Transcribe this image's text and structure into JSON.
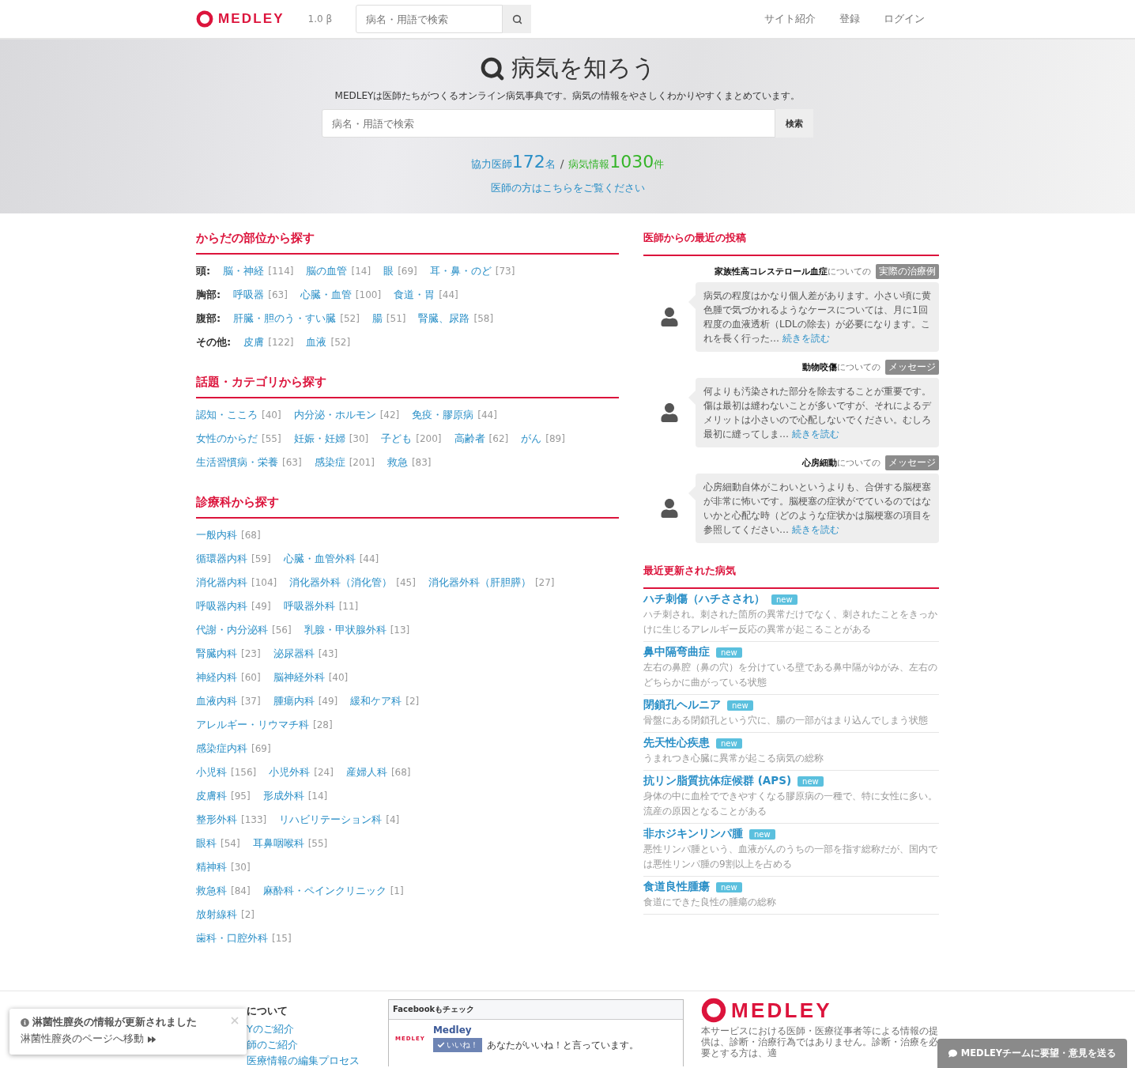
{
  "header": {
    "logo": "MEDLEY",
    "version": "1.0 β",
    "search_placeholder": "病名・用語で検索",
    "nav": [
      "サイト紹介",
      "登録",
      "ログイン"
    ]
  },
  "hero": {
    "title": "病気を知ろう",
    "description": "MEDLEYは医師たちがつくるオンライン病気事典です。病気の情報をやさしくわかりやすくまとめています。",
    "search": {
      "placeholder": "病名・用語で検索",
      "button": "検索"
    },
    "stats": [
      {
        "label": "協力医師",
        "count": "172",
        "unit": "名",
        "color": "#2a8fc7"
      },
      {
        "label": "病気情報",
        "count": "1030",
        "unit": "件",
        "color": "#36b52a"
      }
    ],
    "separator": "/",
    "doctor_link": "医師の方はこちらをご覧ください"
  },
  "body_parts": {
    "title": "からだの部位から探す",
    "rows": [
      {
        "label": "頭:",
        "links": [
          {
            "name": "脳・神経",
            "count": "[114]"
          },
          {
            "name": "脳の血管",
            "count": "[14]"
          },
          {
            "name": "眼",
            "count": "[69]"
          },
          {
            "name": "耳・鼻・のど",
            "count": "[73]"
          }
        ]
      },
      {
        "label": "胸部:",
        "links": [
          {
            "name": "呼吸器",
            "count": "[63]"
          },
          {
            "name": "心臓・血管",
            "count": "[100]"
          },
          {
            "name": "食道・胃",
            "count": "[44]"
          }
        ]
      },
      {
        "label": "腹部:",
        "links": [
          {
            "name": "肝臓・胆のう・すい臓",
            "count": "[52]"
          },
          {
            "name": "腸",
            "count": "[51]"
          },
          {
            "name": "腎臓、尿路",
            "count": "[58]"
          }
        ]
      },
      {
        "label": "その他:",
        "links": [
          {
            "name": "皮膚",
            "count": "[122]"
          },
          {
            "name": "血液",
            "count": "[52]"
          }
        ]
      }
    ]
  },
  "topics": {
    "title": "話題・カテゴリから探す",
    "rows": [
      [
        {
          "name": "認知・こころ",
          "count": "[40]"
        },
        {
          "name": "内分泌・ホルモン",
          "count": "[42]"
        },
        {
          "name": "免疫・膠原病",
          "count": "[44]"
        }
      ],
      [
        {
          "name": "女性のからだ",
          "count": "[55]"
        },
        {
          "name": "妊娠・妊婦",
          "count": "[30]"
        },
        {
          "name": "子ども",
          "count": "[200]"
        },
        {
          "name": "高齢者",
          "count": "[62]"
        },
        {
          "name": "がん",
          "count": "[89]"
        }
      ],
      [
        {
          "name": "生活習慣病・栄養",
          "count": "[63]"
        },
        {
          "name": "感染症",
          "count": "[201]"
        },
        {
          "name": "救急",
          "count": "[83]"
        }
      ]
    ]
  },
  "departments": {
    "title": "診療科から探す",
    "rows": [
      [
        {
          "name": "一般内科",
          "count": "[68]"
        }
      ],
      [
        {
          "name": "循環器内科",
          "count": "[59]"
        },
        {
          "name": "心臓・血管外科",
          "count": "[44]"
        }
      ],
      [
        {
          "name": "消化器内科",
          "count": "[104]"
        },
        {
          "name": "消化器外科（消化管）",
          "count": "[45]"
        },
        {
          "name": "消化器外科（肝胆膵）",
          "count": "[27]"
        }
      ],
      [
        {
          "name": "呼吸器内科",
          "count": "[49]"
        },
        {
          "name": "呼吸器外科",
          "count": "[11]"
        }
      ],
      [
        {
          "name": "代謝・内分泌科",
          "count": "[56]"
        },
        {
          "name": "乳腺・甲状腺外科",
          "count": "[13]"
        }
      ],
      [
        {
          "name": "腎臓内科",
          "count": "[23]"
        },
        {
          "name": "泌尿器科",
          "count": "[43]"
        }
      ],
      [
        {
          "name": "神経内科",
          "count": "[60]"
        },
        {
          "name": "脳神経外科",
          "count": "[40]"
        }
      ],
      [
        {
          "name": "血液内科",
          "count": "[37]"
        },
        {
          "name": "腫瘍内科",
          "count": "[49]"
        },
        {
          "name": "緩和ケア科",
          "count": "[2]"
        }
      ],
      [
        {
          "name": "アレルギー・リウマチ科",
          "count": "[28]"
        }
      ],
      [
        {
          "name": "感染症内科",
          "count": "[69]"
        }
      ],
      [
        {
          "name": "小児科",
          "count": "[156]"
        },
        {
          "name": "小児外科",
          "count": "[24]"
        },
        {
          "name": "産婦人科",
          "count": "[68]"
        }
      ],
      [
        {
          "name": "皮膚科",
          "count": "[95]"
        },
        {
          "name": "形成外科",
          "count": "[14]"
        }
      ],
      [
        {
          "name": "整形外科",
          "count": "[133]"
        },
        {
          "name": "リハビリテーション科",
          "count": "[4]"
        }
      ],
      [
        {
          "name": "眼科",
          "count": "[54]"
        },
        {
          "name": "耳鼻咽喉科",
          "count": "[55]"
        }
      ],
      [
        {
          "name": "精神科",
          "count": "[30]"
        }
      ],
      [
        {
          "name": "救急科",
          "count": "[84]"
        },
        {
          "name": "麻酔科・ペインクリニック",
          "count": "[1]"
        }
      ],
      [
        {
          "name": "放射線科",
          "count": "[2]"
        }
      ],
      [
        {
          "name": "歯科・口腔外科",
          "count": "[15]"
        }
      ]
    ]
  },
  "posts": {
    "title": "医師からの最近の投稿",
    "items": [
      {
        "heading": "**家族性高コレステロール血症**についての",
        "tag": "実際の治療例",
        "body": "病気の程度はかなり個人差があります。小さい頃に黄色腫で気づかれるようなケースについては、月に1回程度の血液透析（LDLの除去）が必要になります。これを長く行った…",
        "more": "続きを読む"
      },
      {
        "heading": "**動物咬傷**についての",
        "tag": "メッセージ",
        "body": "何よりも汚染された部分を除去することが重要です。傷は最初は縫わないことが多いですが、それによるデメリットは小さいので心配しないでください。むしろ最初に縫ってしま…",
        "more": "続きを読む"
      },
      {
        "heading": "**心房細動**についての",
        "tag": "メッセージ",
        "body": "心房細動自体がこわいというよりも、合併する脳梗塞が非常に怖いです。脳梗塞の症状がでているのではないかと心配な時（どのような症状かは脳梗塞の項目を参照してください…",
        "more": "続きを読む"
      }
    ]
  },
  "recent": {
    "title": "最近更新された病気",
    "items": [
      {
        "name": "ハチ刺傷（ハチさされ）",
        "badge": "new",
        "description": "ハチ刺され。刺された箇所の異常だけでなく、刺されたことをきっかけに生じるアレルギー反応の異常が起こることがある"
      },
      {
        "name": "鼻中隔弯曲症",
        "badge": "new",
        "description": "左右の鼻腔（鼻の穴）を分けている壁である鼻中隔がゆがみ、左右のどちらかに曲がっている状態"
      },
      {
        "name": "閉鎖孔ヘルニア",
        "badge": "new",
        "description": "骨盤にある閉鎖孔という穴に、腸の一部がはまり込んでしまう状態"
      },
      {
        "name": "先天性心疾患",
        "badge": "new",
        "description": "うまれつき心臓に異常が起こる病気の総称"
      },
      {
        "name": "抗リン脂質抗体症候群 (APS)",
        "badge": "new",
        "description": "身体の中に血栓でできやすくなる膠原病の一種で、特に女性に多い。流産の原因となることがある"
      },
      {
        "name": "非ホジキンリンパ腫",
        "badge": "new",
        "description": "悪性リンパ腫という、血液がんのうちの一部を指す総称だが、国内では悪性リンパ腫の9割以上を占める"
      },
      {
        "name": "食道良性腫瘍",
        "badge": "new",
        "description": "食道にできた良性の腫瘍の総称"
      }
    ]
  },
  "footer": {
    "about_heading": "について",
    "links": [
      "Yのご紹介",
      "師のご紹介",
      "医療情報の編集プロセス"
    ],
    "facebook": {
      "title": "Facebookもチェック",
      "logo": "MEDLEY",
      "page_name": "Medley",
      "like": "いいね！",
      "like_text": "あなたがいいね！と言っています。"
    },
    "logo": "MEDLEY",
    "disclaimer": "本サービスにおける医師・医療従事者等による情報の提供は、診断・治療行為ではありません。診断・治療を必要とする方は、適"
  },
  "notification": {
    "title": "淋菌性膣炎の情報が更新されました",
    "link": "淋菌性膣炎のページへ移動"
  },
  "feedback_button": "MEDLEYチームに要望・意見を送る"
}
